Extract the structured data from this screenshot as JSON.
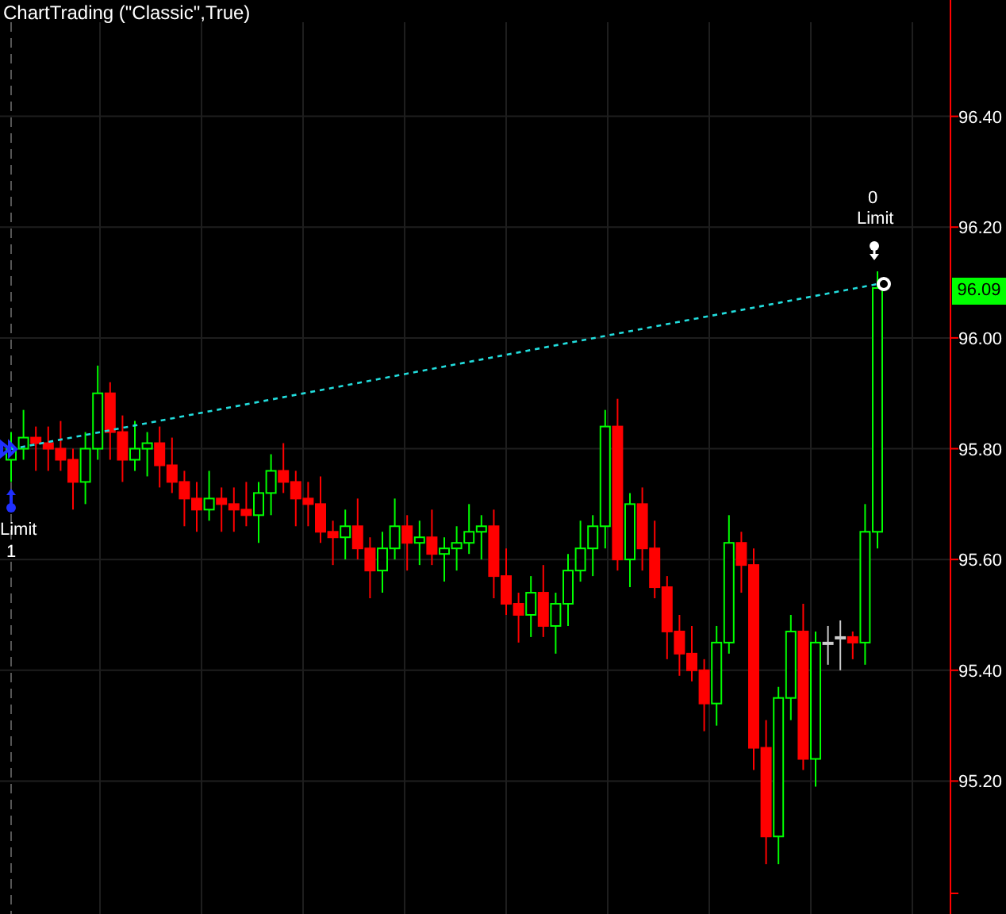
{
  "title": "ChartTrading (\"Classic\",True)",
  "chart": {
    "chart_data": {
      "type": "candlestick",
      "ylim": [
        94.96,
        96.61
      ],
      "grid": true,
      "yticks": [
        {
          "value": 96.4,
          "label": "96.40"
        },
        {
          "value": 96.2,
          "label": "96.20"
        },
        {
          "value": 96.0,
          "label": "96.00"
        },
        {
          "value": 95.8,
          "label": "95.80"
        },
        {
          "value": 95.6,
          "label": "95.60"
        },
        {
          "value": 95.4,
          "label": "95.40"
        },
        {
          "value": 95.2,
          "label": "95.20"
        }
      ],
      "ohlc": [
        [
          95.78,
          95.83,
          95.74,
          95.8
        ],
        [
          95.8,
          95.87,
          95.78,
          95.82
        ],
        [
          95.82,
          95.84,
          95.76,
          95.81
        ],
        [
          95.81,
          95.84,
          95.76,
          95.8
        ],
        [
          95.8,
          95.85,
          95.76,
          95.78
        ],
        [
          95.78,
          95.8,
          95.69,
          95.74
        ],
        [
          95.74,
          95.83,
          95.7,
          95.8
        ],
        [
          95.8,
          95.95,
          95.78,
          95.9
        ],
        [
          95.9,
          95.92,
          95.78,
          95.83
        ],
        [
          95.83,
          95.86,
          95.74,
          95.78
        ],
        [
          95.78,
          95.85,
          95.76,
          95.8
        ],
        [
          95.8,
          95.83,
          95.75,
          95.81
        ],
        [
          95.81,
          95.84,
          95.73,
          95.77
        ],
        [
          95.77,
          95.82,
          95.72,
          95.74
        ],
        [
          95.74,
          95.76,
          95.66,
          95.71
        ],
        [
          95.71,
          95.74,
          95.65,
          95.69
        ],
        [
          95.69,
          95.76,
          95.67,
          95.71
        ],
        [
          95.71,
          95.73,
          95.65,
          95.7
        ],
        [
          95.7,
          95.73,
          95.65,
          95.69
        ],
        [
          95.69,
          95.74,
          95.66,
          95.68
        ],
        [
          95.68,
          95.74,
          95.63,
          95.72
        ],
        [
          95.72,
          95.79,
          95.68,
          95.76
        ],
        [
          95.76,
          95.81,
          95.72,
          95.74
        ],
        [
          95.74,
          95.76,
          95.66,
          95.71
        ],
        [
          95.71,
          95.74,
          95.66,
          95.7
        ],
        [
          95.7,
          95.75,
          95.63,
          95.65
        ],
        [
          95.65,
          95.67,
          95.59,
          95.64
        ],
        [
          95.64,
          95.69,
          95.6,
          95.66
        ],
        [
          95.66,
          95.71,
          95.6,
          95.62
        ],
        [
          95.62,
          95.64,
          95.53,
          95.58
        ],
        [
          95.58,
          95.65,
          95.54,
          95.62
        ],
        [
          95.62,
          95.71,
          95.6,
          95.66
        ],
        [
          95.66,
          95.68,
          95.58,
          95.63
        ],
        [
          95.63,
          95.67,
          95.59,
          95.64
        ],
        [
          95.64,
          95.69,
          95.59,
          95.61
        ],
        [
          95.61,
          95.64,
          95.56,
          95.62
        ],
        [
          95.62,
          95.66,
          95.58,
          95.63
        ],
        [
          95.63,
          95.7,
          95.61,
          95.65
        ],
        [
          95.65,
          95.68,
          95.6,
          95.66
        ],
        [
          95.66,
          95.69,
          95.53,
          95.57
        ],
        [
          95.57,
          95.62,
          95.5,
          95.52
        ],
        [
          95.52,
          95.54,
          95.45,
          95.5
        ],
        [
          95.5,
          95.57,
          95.46,
          95.54
        ],
        [
          95.54,
          95.59,
          95.46,
          95.48
        ],
        [
          95.48,
          95.54,
          95.43,
          95.52
        ],
        [
          95.52,
          95.61,
          95.48,
          95.58
        ],
        [
          95.58,
          95.67,
          95.56,
          95.62
        ],
        [
          95.62,
          95.68,
          95.57,
          95.66
        ],
        [
          95.66,
          95.87,
          95.62,
          95.84
        ],
        [
          95.84,
          95.89,
          95.58,
          95.6
        ],
        [
          95.6,
          95.72,
          95.55,
          95.7
        ],
        [
          95.7,
          95.73,
          95.58,
          95.62
        ],
        [
          95.62,
          95.67,
          95.53,
          95.55
        ],
        [
          95.55,
          95.57,
          95.42,
          95.47
        ],
        [
          95.47,
          95.5,
          95.39,
          95.43
        ],
        [
          95.43,
          95.48,
          95.38,
          95.4
        ],
        [
          95.4,
          95.42,
          95.29,
          95.34
        ],
        [
          95.34,
          95.48,
          95.3,
          95.45
        ],
        [
          95.45,
          95.68,
          95.43,
          95.63
        ],
        [
          95.63,
          95.65,
          95.54,
          95.59
        ],
        [
          95.59,
          95.62,
          95.22,
          95.26
        ],
        [
          95.26,
          95.31,
          95.05,
          95.1
        ],
        [
          95.1,
          95.37,
          95.05,
          95.35
        ],
        [
          95.35,
          95.5,
          95.31,
          95.47
        ],
        [
          95.47,
          95.52,
          95.22,
          95.24
        ],
        [
          95.24,
          95.47,
          95.19,
          95.45
        ],
        [
          95.45,
          95.48,
          95.41,
          95.45
        ],
        [
          95.46,
          95.49,
          95.4,
          95.46
        ],
        [
          95.46,
          95.47,
          95.42,
          95.45
        ],
        [
          95.45,
          95.7,
          95.41,
          95.65
        ],
        [
          95.65,
          96.12,
          95.62,
          96.09
        ]
      ]
    },
    "last_price": "96.09"
  },
  "orders": [
    {
      "kind": "entry",
      "type": "Limit",
      "quantity": "1"
    },
    {
      "kind": "exit",
      "quantity": "0",
      "type": "Limit"
    }
  ]
}
